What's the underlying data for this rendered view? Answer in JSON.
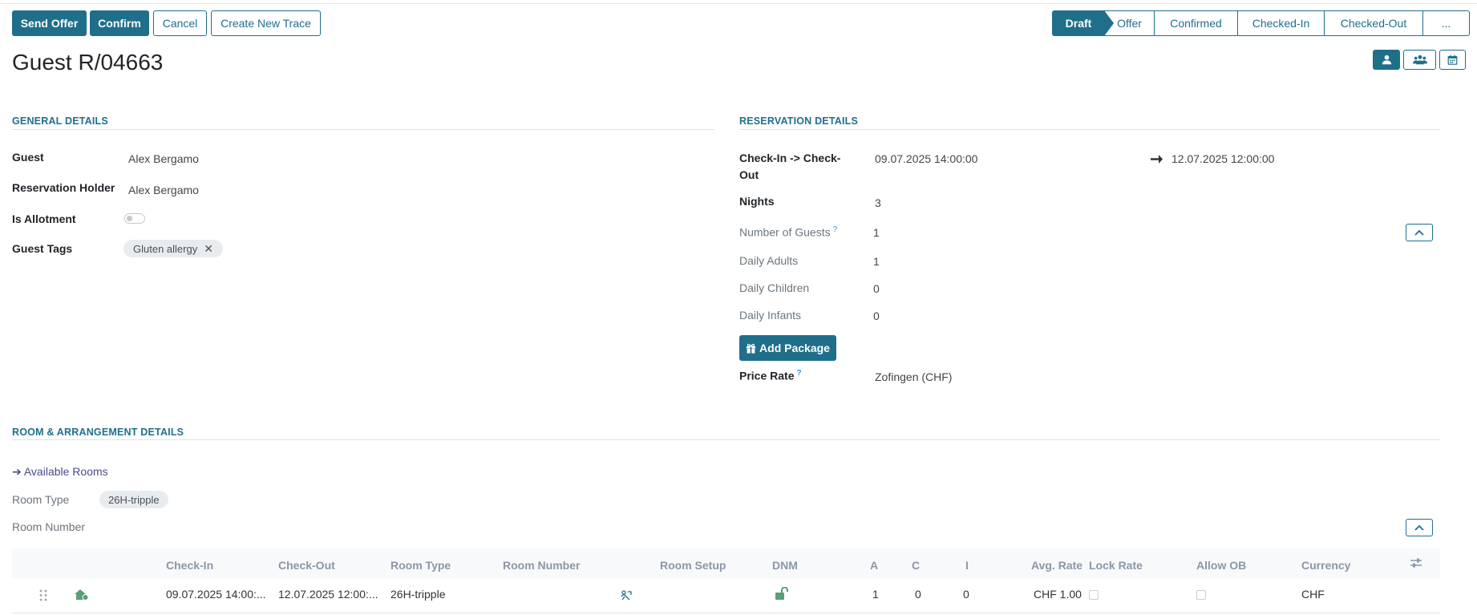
{
  "toolbar": {
    "send_offer": "Send Offer",
    "confirm": "Confirm",
    "cancel": "Cancel",
    "create_trace": "Create New Trace"
  },
  "status_stages": [
    "Draft",
    "Offer",
    "Confirmed",
    "Checked-In",
    "Checked-Out",
    "..."
  ],
  "active_stage": "Draft",
  "title": "Guest R/04663",
  "view_icons": [
    "user-icon",
    "users-icon",
    "calendar-icon"
  ],
  "general": {
    "section_title": "GENERAL DETAILS",
    "guest_label": "Guest",
    "guest_value": "Alex Bergamo",
    "holder_label": "Reservation Holder",
    "holder_value": "Alex Bergamo",
    "allotment_label": "Is Allotment",
    "allotment_on": false,
    "tags_label": "Guest Tags",
    "tag": "Gluten allergy",
    "tag_remove": "✕"
  },
  "reservation": {
    "section_title": "RESERVATION DETAILS",
    "checkin_label_1": "Check-In -> Check-",
    "checkin_label_2": "Out",
    "checkin_value": "09.07.2025 14:00:00",
    "checkout_value": "12.07.2025 12:00:00",
    "nights_label": "Nights",
    "nights_value": "3",
    "guests_label": "Number of Guests",
    "guests_help": "?",
    "guests_value": "1",
    "adults_label": "Daily Adults",
    "adults_value": "1",
    "children_label": "Daily Children",
    "children_value": "0",
    "infants_label": "Daily Infants",
    "infants_value": "0",
    "add_package": "Add Package",
    "price_rate_label": "Price Rate",
    "price_rate_help": "?",
    "price_rate_value": "Zofingen (CHF)"
  },
  "room": {
    "section_title": "ROOM & ARRANGEMENT DETAILS",
    "available_rooms": "➔ Available Rooms",
    "room_type_label": "Room Type",
    "room_type_tag": "26H-tripple",
    "room_number_label": "Room Number"
  },
  "table": {
    "headers": [
      "Check-In",
      "Check-Out",
      "Room Type",
      "Room Number",
      "Room Setup",
      "DNM",
      "A",
      "C",
      "I",
      "Avg. Rate",
      "Lock Rate",
      "Allow OB",
      "Currency"
    ],
    "row": {
      "checkin": "09.07.2025 14:00:...",
      "checkout": "12.07.2025 12:00:...",
      "room_type": "26H-tripple",
      "a": "1",
      "c": "0",
      "i": "0",
      "avg_rate": "CHF 1.00",
      "currency": "CHF"
    }
  },
  "colors": {
    "primary": "#1f6f8b",
    "icon_green": "#5a9e7a",
    "link": "#4b4a89"
  }
}
